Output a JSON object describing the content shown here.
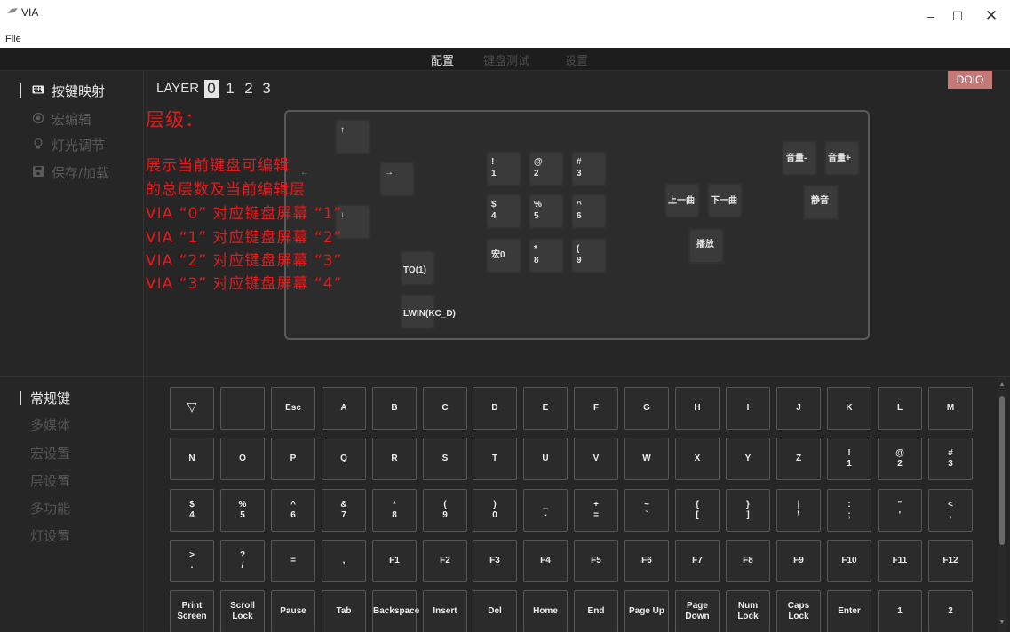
{
  "window": {
    "title": "VIA",
    "file_menu": "File",
    "min_glyph": "–",
    "max_glyph": "☐",
    "close_glyph": "✕"
  },
  "topnav": {
    "config": "配置",
    "keytest": "键盘测试",
    "settings": "设置"
  },
  "sidebar": {
    "items": [
      {
        "label": "按键映射",
        "icon": "keyboard-icon",
        "active": true
      },
      {
        "label": "宏编辑",
        "icon": "record-icon",
        "active": false
      },
      {
        "label": "灯光调节",
        "icon": "lightbulb-icon",
        "active": false
      },
      {
        "label": "保存/加载",
        "icon": "save-icon",
        "active": false
      }
    ]
  },
  "layers": {
    "label": "LAYER",
    "numbers": [
      "0",
      "1",
      "2",
      "3"
    ],
    "selected": "0"
  },
  "brand": "DOIO",
  "annotation": {
    "title": "层级：",
    "lines": [
      "展示当前键盘可编辑",
      "的总层数及当前编辑层",
      "VIA “0” 对应键盘屏幕 “1”",
      "VIA “1” 对应键盘屏幕 “2”",
      "VIA “2” 对应键盘屏幕 “3”",
      "VIA “3” 对应键盘屏幕 “4”"
    ]
  },
  "layout_keys": [
    {
      "label": "↑",
      "name": "up-arrow-key"
    },
    {
      "label": "→",
      "name": "right-arrow-key"
    },
    {
      "label": "←",
      "name": "left-arrow-key"
    },
    {
      "label": "↓",
      "name": "down-arrow-key"
    },
    {
      "label": "TO(1)",
      "name": "to1-key"
    },
    {
      "label": "LWIN(KC_D)",
      "name": "lwin-kcd-key"
    },
    {
      "label": "!\n1",
      "name": "key-1"
    },
    {
      "label": "@\n2",
      "name": "key-2"
    },
    {
      "label": "#\n3",
      "name": "key-3"
    },
    {
      "label": "$\n4",
      "name": "key-4"
    },
    {
      "label": "%\n5",
      "name": "key-5"
    },
    {
      "label": "^\n6",
      "name": "key-6"
    },
    {
      "label": "宏0",
      "name": "macro0-key"
    },
    {
      "label": "*\n8",
      "name": "key-8"
    },
    {
      "label": "(\n9",
      "name": "key-9"
    },
    {
      "label": "上一曲",
      "name": "prev-track-key"
    },
    {
      "label": "下一曲",
      "name": "next-track-key"
    },
    {
      "label": "播放",
      "name": "play-key"
    },
    {
      "label": "音量-",
      "name": "volume-down-key"
    },
    {
      "label": "音量+",
      "name": "volume-up-key"
    },
    {
      "label": "静音",
      "name": "mute-key"
    }
  ],
  "categories": {
    "items": [
      {
        "label": "常规键",
        "active": true
      },
      {
        "label": "多媒体",
        "active": false
      },
      {
        "label": "宏设置",
        "active": false
      },
      {
        "label": "层设置",
        "active": false
      },
      {
        "label": "多功能",
        "active": false
      },
      {
        "label": "灯设置",
        "active": false
      }
    ]
  },
  "palette": {
    "rows": [
      [
        "▽",
        "",
        "Esc",
        "A",
        "B",
        "C",
        "D",
        "E",
        "F",
        "G",
        "H",
        "I",
        "J",
        "K",
        "L",
        "M"
      ],
      [
        "N",
        "O",
        "P",
        "Q",
        "R",
        "S",
        "T",
        "U",
        "V",
        "W",
        "X",
        "Y",
        "Z",
        "!\n1",
        "@\n2",
        "#\n3"
      ],
      [
        "$\n4",
        "%\n5",
        "^\n6",
        "&\n7",
        "*\n8",
        "(\n9",
        ")\n0",
        "_\n-",
        "+\n=",
        "~\n`",
        "{\n[",
        "}\n]",
        "|\n\\",
        ":\n;",
        "\"\n'",
        "<\n,"
      ],
      [
        ">\n.",
        "?\n/",
        "=",
        ",",
        "F1",
        "F2",
        "F3",
        "F4",
        "F5",
        "F6",
        "F7",
        "F8",
        "F9",
        "F10",
        "F11",
        "F12"
      ],
      [
        "Print\nScreen",
        "Scroll\nLock",
        "Pause",
        "Tab",
        "Backspace",
        "Insert",
        "Del",
        "Home",
        "End",
        "Page Up",
        "Page\nDown",
        "Num\nLock",
        "Caps\nLock",
        "Enter",
        "1",
        "2"
      ]
    ]
  },
  "scrollbar": {
    "up_glyph": "▲",
    "down_glyph": "▼"
  },
  "colors": {
    "background": "#262626",
    "annotation_red": "#e8191b",
    "brand_badge": "#c47878",
    "active_text": "#e8e8e8",
    "inactive_text": "#555555"
  }
}
